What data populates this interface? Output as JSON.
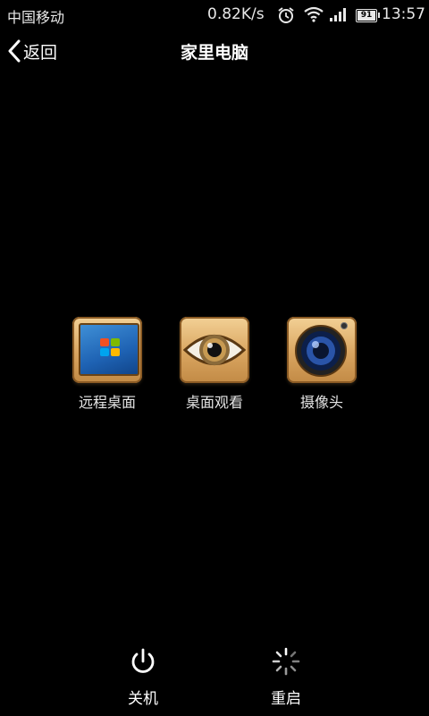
{
  "status_bar": {
    "carrier": "中国移动",
    "net_speed": "0.82K/s",
    "battery": "91",
    "time": "13:57"
  },
  "header": {
    "back_label": "返回",
    "title": "家里电脑"
  },
  "features": [
    {
      "label": "远程桌面",
      "icon": "windows-desktop-icon"
    },
    {
      "label": "桌面观看",
      "icon": "eye-icon"
    },
    {
      "label": "摄像头",
      "icon": "camera-lens-icon"
    }
  ],
  "bottom_bar": {
    "shutdown_label": "关机",
    "restart_label": "重启"
  },
  "colors": {
    "background": "#000000",
    "tile_wood": "#d9a560",
    "text": "#ffffff"
  }
}
